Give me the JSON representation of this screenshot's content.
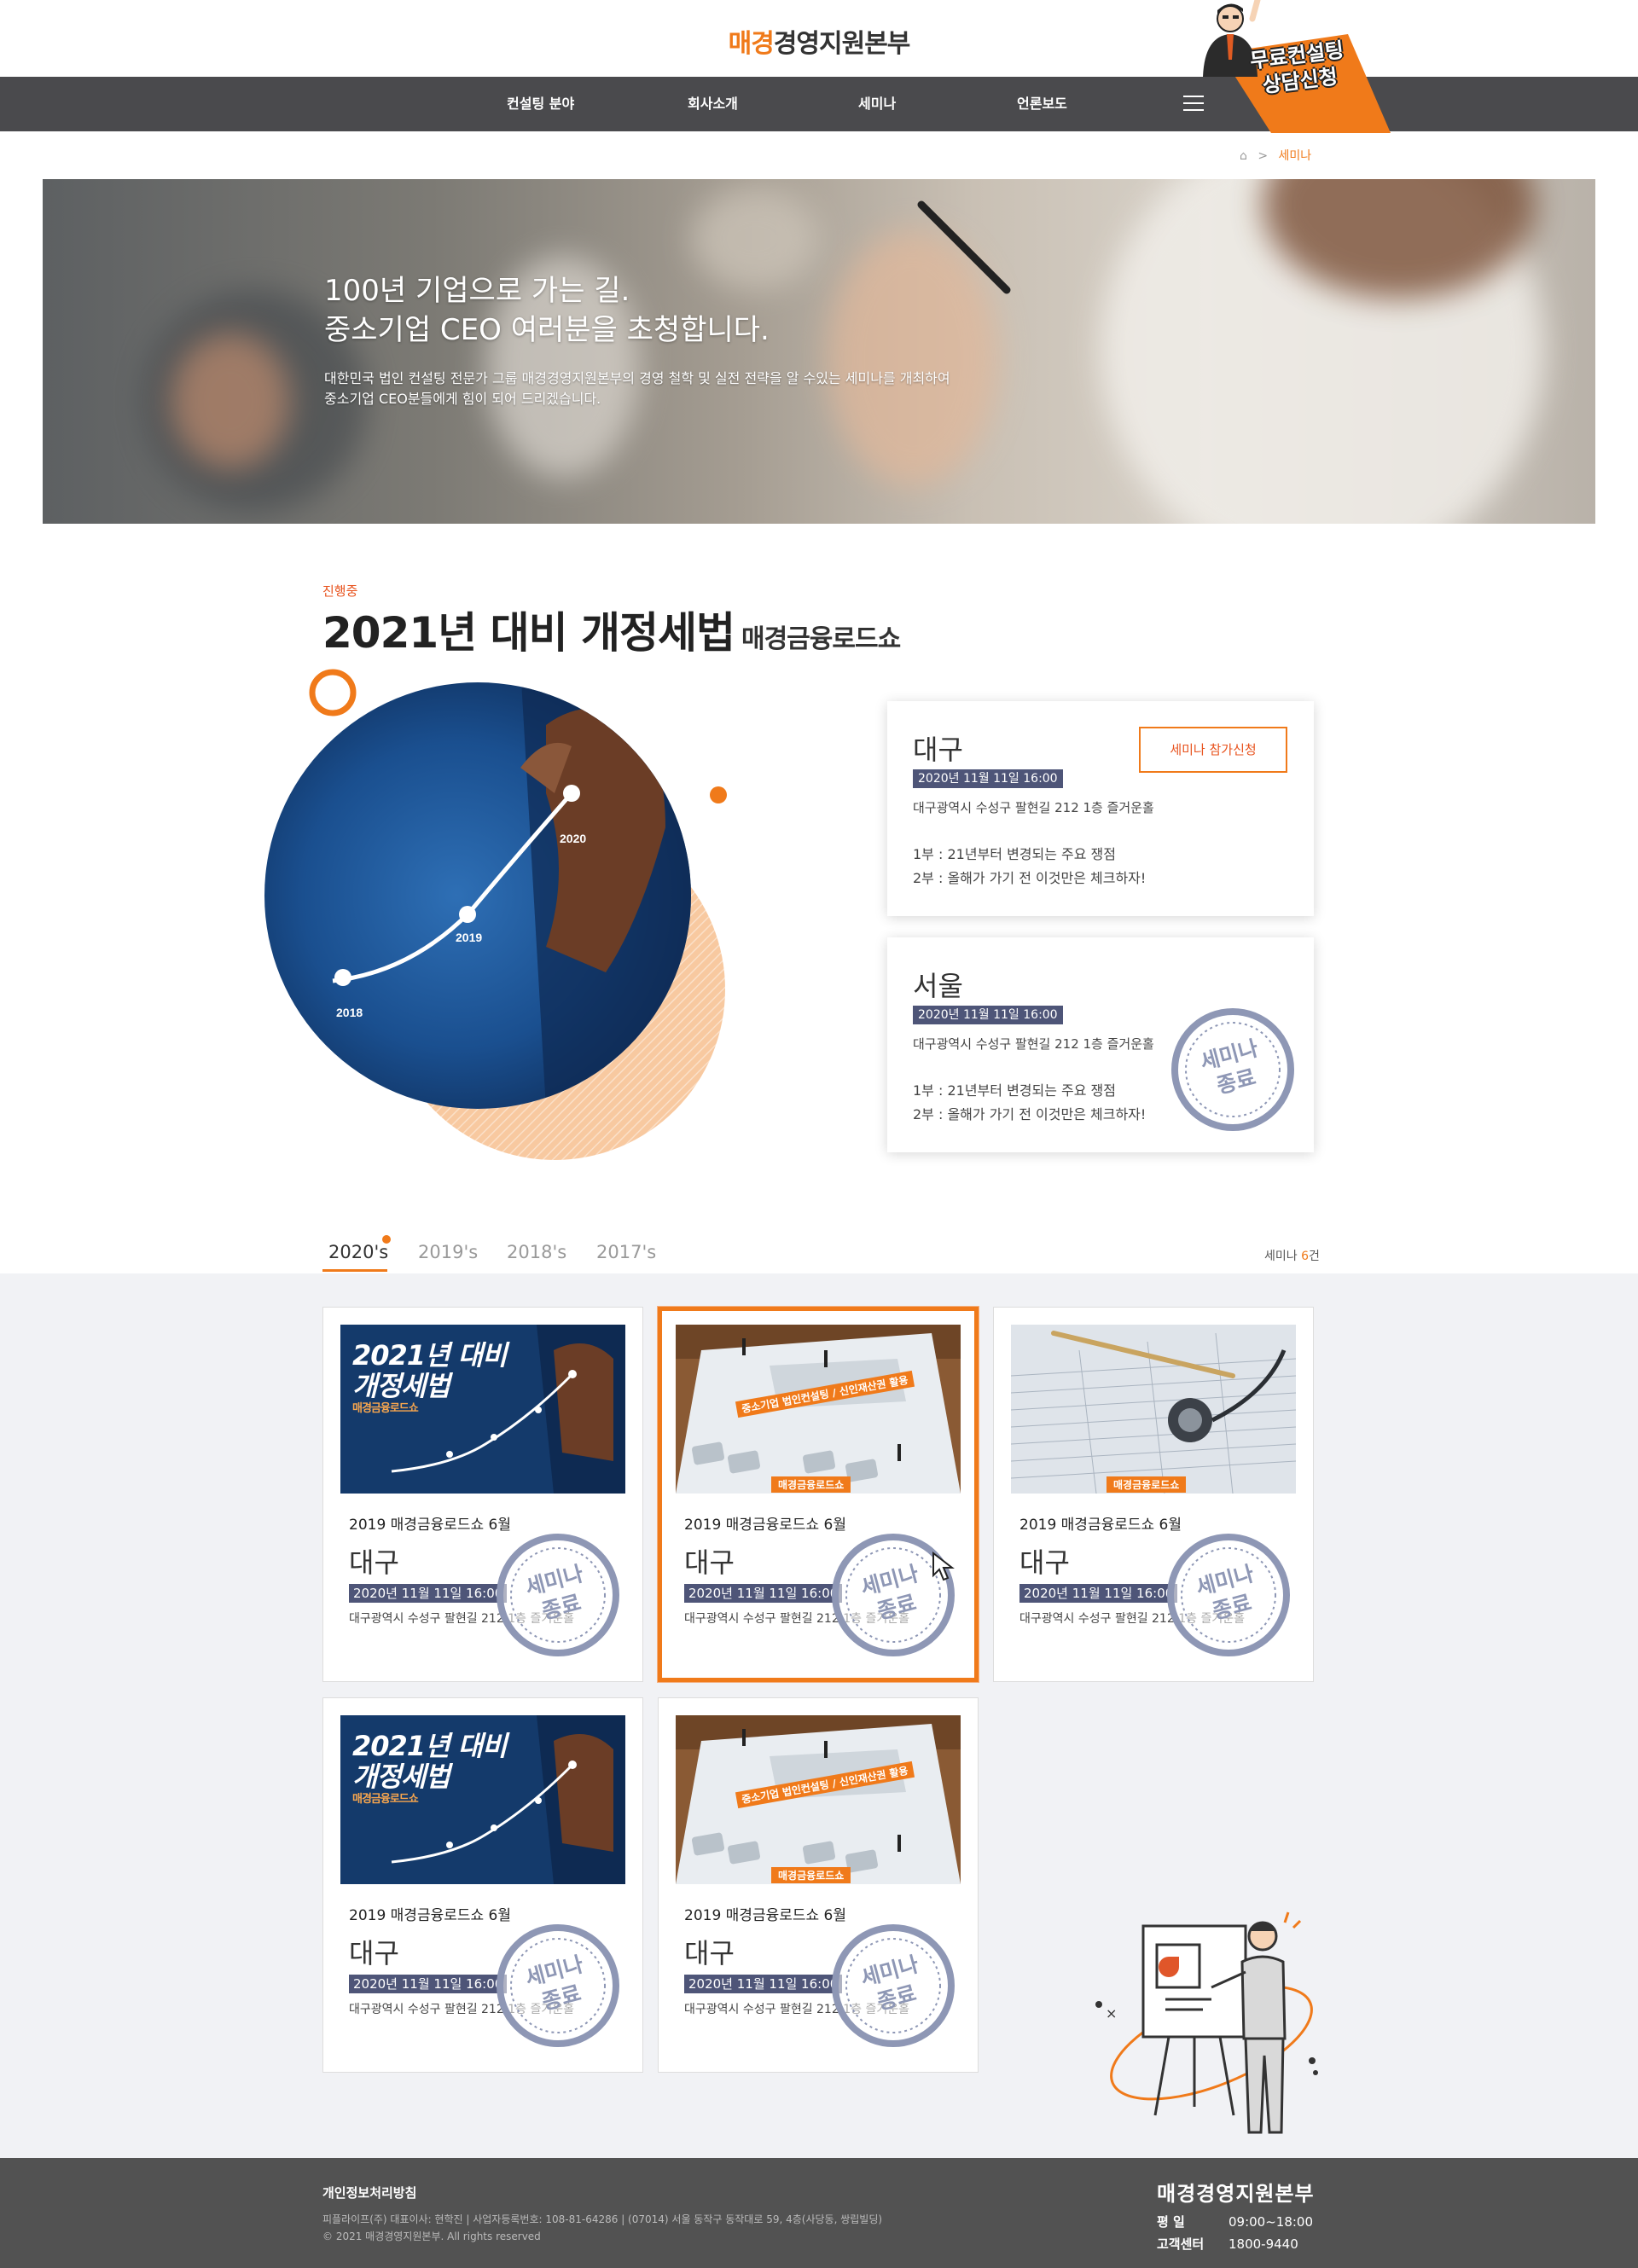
{
  "header": {
    "logo_accent": "매경",
    "logo_rest": "경영지원본부",
    "nav": [
      "컨설팅 분야",
      "회사소개",
      "세미나",
      "언론보도"
    ],
    "promo_line1": "무료컨설팅",
    "promo_line2": "상담신청"
  },
  "breadcrumb": {
    "current": "세미나",
    "separator": ">"
  },
  "hero": {
    "title_line1": "100년 기업으로 가는 길.",
    "title_line2": "중소기업 CEO 여러분을 초청합니다.",
    "desc_line1": "대한민국 법인 컨설팅 전문가 그룹 매경경영지원본부의 경영 철학 및 실전 전략을 알 수있는 세미나를 개최하여",
    "desc_line2": "중소기업 CEO분들에게 힘이 되어 드리겠습니다."
  },
  "event": {
    "status": "진행중",
    "title": "2021년 대비 개정세법",
    "subtitle": "매경금융로드쇼",
    "graph_labels": [
      "2018",
      "2019",
      "2020"
    ],
    "sessions": [
      {
        "city": "대구",
        "date": "2020년 11월 11일 16:00",
        "address": "대구광역시 수성구 팔현길 212 1층 즐거운홀",
        "part1": "1부 : 21년부터 변경되는 주요 쟁점",
        "part2": "2부 : 올해가 가기 전 이것만은 체크하자!",
        "button": "세미나 참가신청"
      },
      {
        "city": "서울",
        "date": "2020년 11월 11일 16:00",
        "address": "대구광역시 수성구 팔현길 212 1층 즐거운홀",
        "part1": "1부 : 21년부터 변경되는 주요 쟁점",
        "part2": "2부 : 올해가 가기 전 이것만은 체크하자!",
        "stamp_line1": "세미나",
        "stamp_line2": "종료"
      }
    ]
  },
  "tabs": {
    "years": [
      "2020's",
      "2019's",
      "2018's",
      "2017's"
    ],
    "active": "2020's",
    "count_prefix": "세미나",
    "count_value": "6",
    "count_suffix": "건"
  },
  "list": {
    "stamp_line1": "세미나",
    "stamp_line2": "종료",
    "thumb_blue_title1": "2021년 대비",
    "thumb_blue_title2": "개정세법",
    "thumb_blue_sub": "매경금융로드쇼",
    "thumb_calc_banner": "중소기업 법인컨설팅 / 신인재산권 활용",
    "thumb_tag": "매경금융로드쇼",
    "items": [
      {
        "title": "2019 매경금융로드쇼 6월",
        "city": "대구",
        "date": "2020년 11월 11일 16:00",
        "address": "대구광역시 수성구 팔현길 212 1층 즐거운홀",
        "thumb": "blue"
      },
      {
        "title": "2019 매경금융로드쇼 6월",
        "city": "대구",
        "date": "2020년 11월 11일 16:00",
        "address": "대구광역시 수성구 팔현길 212 1층 즐거운홀",
        "thumb": "calc"
      },
      {
        "title": "2019 매경금융로드쇼 6월",
        "city": "대구",
        "date": "2020년 11월 11일 16:00",
        "address": "대구광역시 수성구 팔현길 212 1층 즐거운홀",
        "thumb": "paper"
      },
      {
        "title": "2019 매경금융로드쇼 6월",
        "city": "대구",
        "date": "2020년 11월 11일 16:00",
        "address": "대구광역시 수성구 팔현길 212 1층 즐거운홀",
        "thumb": "blue"
      },
      {
        "title": "2019 매경금융로드쇼 6월",
        "city": "대구",
        "date": "2020년 11월 11일 16:00",
        "address": "대구광역시 수성구 팔현길 212 1층 즐거운홀",
        "thumb": "calc"
      }
    ]
  },
  "footer": {
    "policy": "개인정보처리방침",
    "company_line": "피플라이프(주) 대표이사: 현학진  |  사업자등록번호: 108-81-64286  |  (07014) 서울 동작구 동작대로 59, 4층(사당동, 쌍립빌딩)",
    "copyright": "© 2021 매경경영지원본부. All rights reserved",
    "brand": "매경경영지원본부",
    "hours_label": "평      일",
    "hours_value": "09:00~18:00",
    "center_label": "고객센터",
    "center_value": "1800-9440"
  },
  "colors": {
    "accent": "#f07a1a",
    "nav_bg": "#4a4a4d",
    "chip": "#4e5578",
    "footer_bg": "#525252"
  }
}
